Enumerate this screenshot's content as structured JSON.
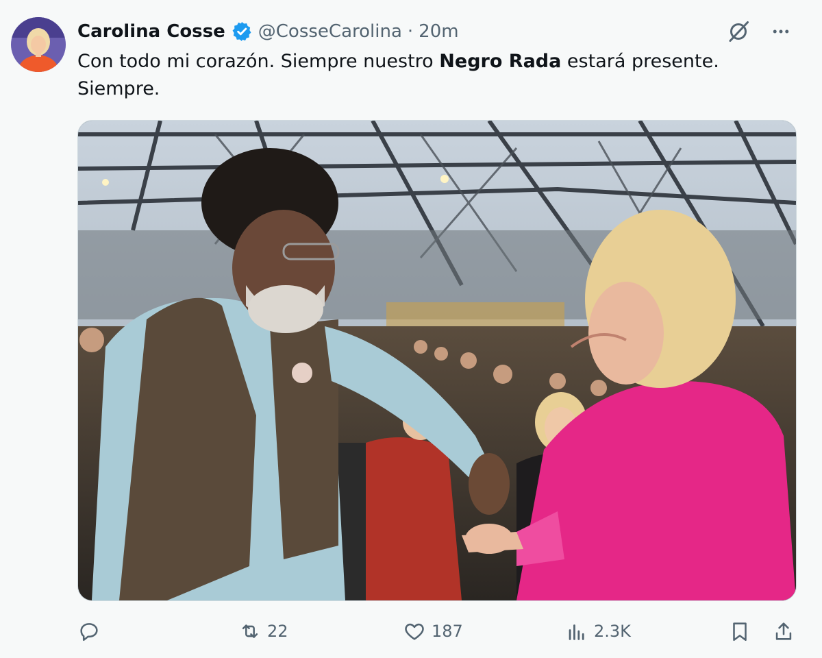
{
  "tweet": {
    "author_name": "Carolina Cosse",
    "author_handle": "@CosseCarolina",
    "separator": "·",
    "time": "20m",
    "text_part1": "Con todo mi corazón. Siempre nuestro ",
    "text_bold": "Negro Rada",
    "text_part2": " estará presente. Siempre."
  },
  "stats": {
    "retweets": "22",
    "likes": "187",
    "views": "2.3K"
  },
  "colors": {
    "verified": "#1d9bf0",
    "muted": "#536471",
    "text": "#0f1419",
    "background": "#f7f9f9"
  },
  "icons": [
    "verified-icon",
    "grok-icon",
    "more-icon",
    "reply-icon",
    "retweet-icon",
    "like-icon",
    "views-icon",
    "bookmark-icon",
    "share-icon"
  ]
}
